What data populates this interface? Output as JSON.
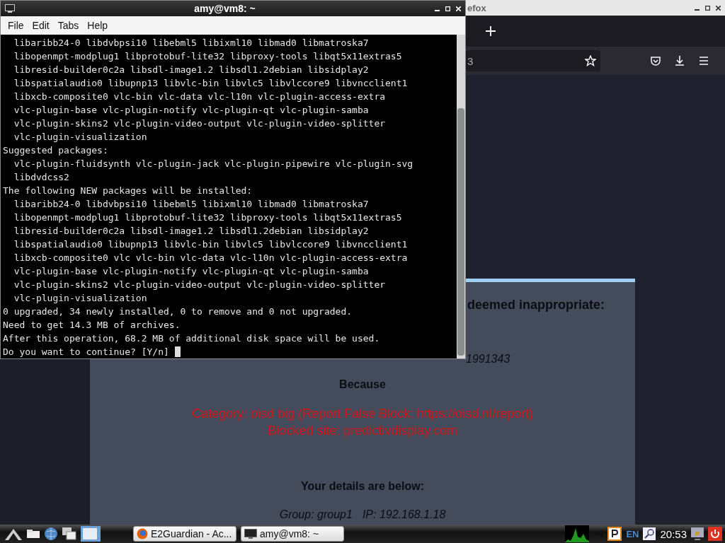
{
  "terminal": {
    "title": "amy@vm8: ~",
    "menu": [
      "File",
      "Edit",
      "Tabs",
      "Help"
    ],
    "lines": [
      "  libaribb24-0 libdvbpsi10 libebml5 libixml10 libmad0 libmatroska7",
      "  libopenmpt-modplug1 libprotobuf-lite32 libproxy-tools libqt5x11extras5",
      "  libresid-builder0c2a libsdl-image1.2 libsdl1.2debian libsidplay2",
      "  libspatialaudio0 libupnp13 libvlc-bin libvlc5 libvlccore9 libvncclient1",
      "  libxcb-composite0 vlc-bin vlc-data vlc-l10n vlc-plugin-access-extra",
      "  vlc-plugin-base vlc-plugin-notify vlc-plugin-qt vlc-plugin-samba",
      "  vlc-plugin-skins2 vlc-plugin-video-output vlc-plugin-video-splitter",
      "  vlc-plugin-visualization",
      "Suggested packages:",
      "  vlc-plugin-fluidsynth vlc-plugin-jack vlc-plugin-pipewire vlc-plugin-svg",
      "  libdvdcss2",
      "The following NEW packages will be installed:",
      "  libaribb24-0 libdvbpsi10 libebml5 libixml10 libmad0 libmatroska7",
      "  libopenmpt-modplug1 libprotobuf-lite32 libproxy-tools libqt5x11extras5",
      "  libresid-builder0c2a libsdl-image1.2 libsdl1.2debian libsidplay2",
      "  libspatialaudio0 libupnp13 libvlc-bin libvlc5 libvlccore9 libvncclient1",
      "  libxcb-composite0 vlc vlc-bin vlc-data vlc-l10n vlc-plugin-access-extra",
      "  vlc-plugin-base vlc-plugin-notify vlc-plugin-qt vlc-plugin-samba",
      "  vlc-plugin-skins2 vlc-plugin-video-output vlc-plugin-video-splitter",
      "  vlc-plugin-visualization",
      "0 upgraded, 34 newly installed, 0 to remove and 0 not upgraded.",
      "Need to get 14.3 MB of archives.",
      "After this operation, 68.2 MB of additional disk space will be used."
    ],
    "prompt": "Do you want to continue? [Y/n]"
  },
  "browser": {
    "title": "efox",
    "address": "3",
    "page": {
      "heading": "deemed inappropriate:",
      "url": "1991343",
      "because": "Because",
      "category": "Category: oisd big (Report False Block: https://oisd.nl/report)",
      "blocked_site": "Blocked site: predictivdisplay.com",
      "details_heading": "Your details are below:",
      "group": "Group: group1",
      "ip": "IP: 192.168.1.18"
    }
  },
  "taskbar": {
    "tasks": [
      {
        "label": "E2Guardian - Ac...",
        "kind": "browser"
      },
      {
        "label": "amy@vm8: ~",
        "kind": "terminal"
      }
    ],
    "language": "EN",
    "clock": "20:53"
  }
}
